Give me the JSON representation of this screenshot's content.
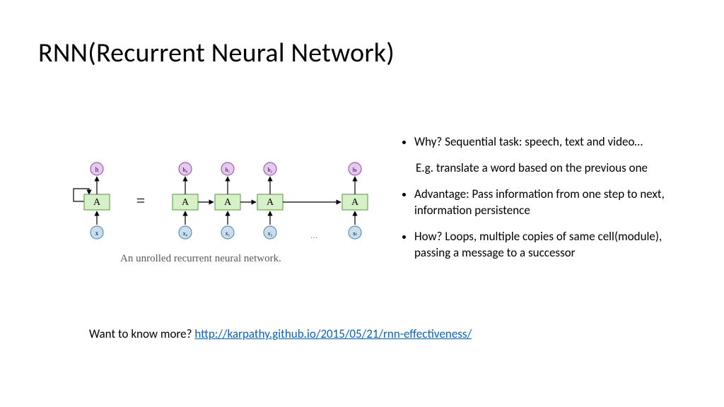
{
  "title": "RNN(Recurrent Neural Network)",
  "bullets": [
    {
      "text": "Why? Sequential task: speech, text and video…",
      "sub": "E.g. translate a word based on the previous one"
    },
    {
      "text": "Advantage: Pass information from one step to next, information persistence"
    },
    {
      "text": "How? Loops, multiple copies of same cell(module), passing a message to a successor"
    }
  ],
  "figure": {
    "caption": "An unrolled recurrent neural network.",
    "cell_label": "A",
    "folded": {
      "h": "h",
      "x": "x"
    },
    "unrolled": [
      {
        "h": "h₀",
        "x": "x₀"
      },
      {
        "h": "h₁",
        "x": "x₁"
      },
      {
        "h": "h₂",
        "x": "x₂"
      },
      {
        "h": "hₜ",
        "x": "xₜ"
      }
    ],
    "ellipsis": "…",
    "equals": "="
  },
  "footer": {
    "prefix": "Want to know more? ",
    "link_text": "http://karpathy.github.io/2015/05/21/rnn-effectiveness/",
    "link_href": "http://karpathy.github.io/2015/05/21/rnn-effectiveness/"
  }
}
